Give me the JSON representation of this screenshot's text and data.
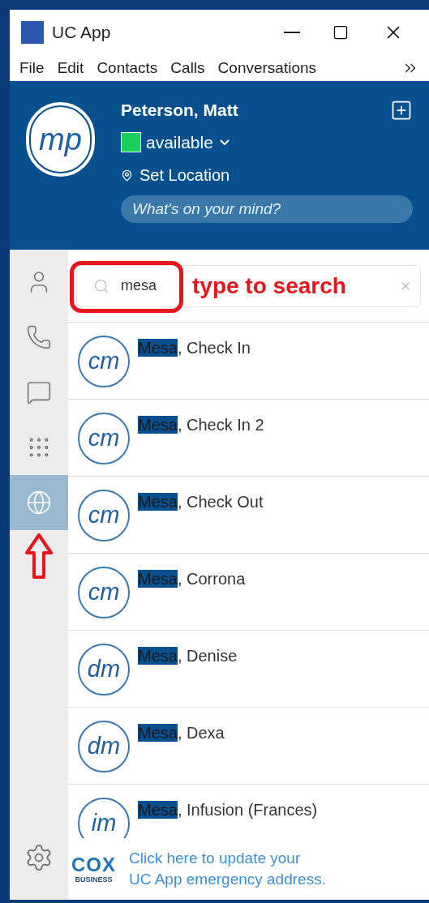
{
  "window": {
    "title": "UC App"
  },
  "menu": [
    "File",
    "Edit",
    "Contacts",
    "Calls",
    "Conversations"
  ],
  "profile": {
    "initials": "mp",
    "name": "Peterson, Matt",
    "status": "available",
    "location": "Set Location",
    "mood_placeholder": "What's on your mind?"
  },
  "sidebar": [
    {
      "kind": "contacts",
      "selected": false
    },
    {
      "kind": "history",
      "selected": false
    },
    {
      "kind": "chat",
      "selected": false
    },
    {
      "kind": "dialpad",
      "selected": false
    },
    {
      "kind": "directory",
      "selected": true
    }
  ],
  "search": {
    "value": "mesa",
    "annotation": "type to search"
  },
  "contacts": [
    {
      "initials": "cm",
      "match": "Mesa",
      "rest": ", Check In"
    },
    {
      "initials": "cm",
      "match": "Mesa",
      "rest": ", Check In 2"
    },
    {
      "initials": "cm",
      "match": "Mesa",
      "rest": ", Check Out"
    },
    {
      "initials": "cm",
      "match": "Mesa",
      "rest": ", Corrona"
    },
    {
      "initials": "dm",
      "match": "Mesa",
      "rest": ", Denise"
    },
    {
      "initials": "dm",
      "match": "Mesa",
      "rest": ", Dexa"
    },
    {
      "initials": "im",
      "match": "Mesa",
      "rest": ", Infusion (Frances)"
    }
  ],
  "footer": {
    "logo": "COX",
    "logo_sub": "BUSINESS",
    "link_lines": [
      "Click here to update your",
      "UC App emergency address."
    ]
  }
}
